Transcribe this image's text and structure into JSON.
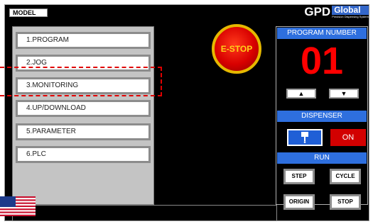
{
  "topbar": {
    "model_label": "MODEL"
  },
  "logo": {
    "brand": "GPD",
    "brand_box": "Global",
    "tagline": "Precision Dispensing System"
  },
  "menu": {
    "items": [
      {
        "label": "1.PROGRAM"
      },
      {
        "label": "2.JOG"
      },
      {
        "label": "3.MONITORING"
      },
      {
        "label": "4.UP/DOWNLOAD"
      },
      {
        "label": "5.PARAMETER"
      },
      {
        "label": "6.PLC"
      }
    ]
  },
  "estop": {
    "label": "E-STOP"
  },
  "program": {
    "title": "PROGRAM NUMBER",
    "number": "01",
    "up_icon": "triangle-up",
    "down_icon": "triangle-down"
  },
  "dispenser": {
    "title": "DISPENSER",
    "on_label": "ON",
    "icon": "dispense-needle"
  },
  "run": {
    "title": "RUN",
    "step_label": "STEP",
    "cycle_label": "CYCLE",
    "origin_label": "ORIGIN",
    "stop_label": "STOP"
  },
  "colors": {
    "accent_blue": "#2e6fde",
    "alert_red": "#ff0000",
    "highlight_dash": "#e00000"
  },
  "flag": {
    "icon": "us-flag"
  }
}
